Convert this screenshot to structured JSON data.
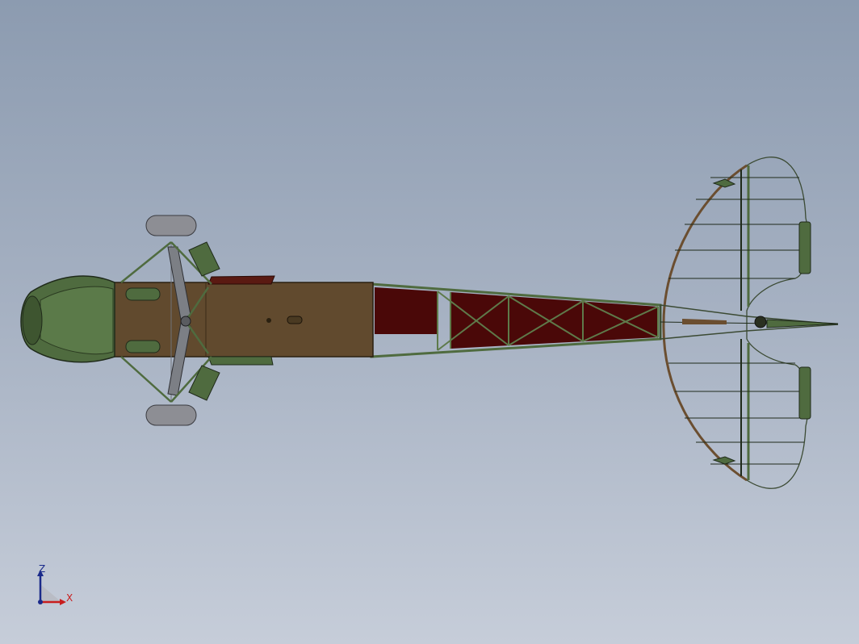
{
  "view": {
    "model": "aircraft-top-view",
    "colors": {
      "background_top": "#8c9bb0",
      "background_bottom": "#c6cdd9",
      "body_green": "#4f6b3f",
      "deck_brown": "#614a2e",
      "fabric_maroon": "#4a0808",
      "wheel_gray": "#8d8e94",
      "axis_z": "#1a2a8a",
      "axis_x": "#c81e1e"
    }
  },
  "triad": {
    "z_label": "Z",
    "x_label": "X"
  }
}
